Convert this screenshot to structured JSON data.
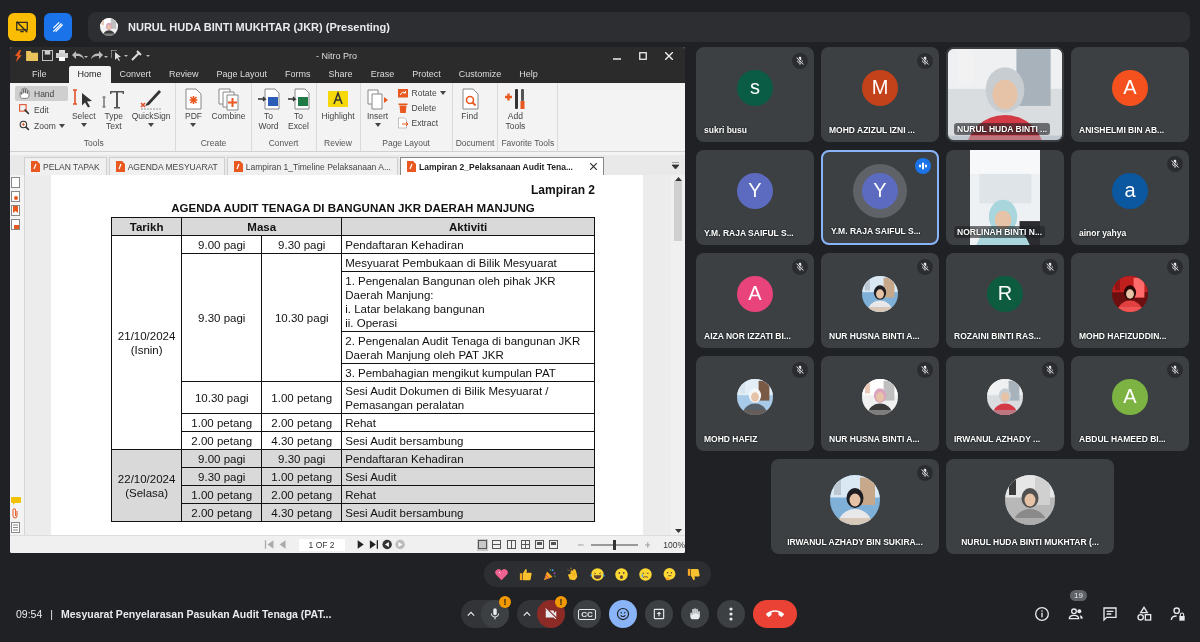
{
  "meet": {
    "presenter": "NURUL HUDA BINTI MUKHTAR (JKR) (Presenting)"
  },
  "nitro": {
    "title": "- Nitro Pro",
    "menu": [
      {
        "label": "File",
        "selected": false
      },
      {
        "label": "Home",
        "selected": true
      },
      {
        "label": "Convert",
        "selected": false
      },
      {
        "label": "Review",
        "selected": false
      },
      {
        "label": "Page Layout",
        "selected": false
      },
      {
        "label": "Forms",
        "selected": false
      },
      {
        "label": "Share",
        "selected": false
      },
      {
        "label": "Erase",
        "selected": false
      },
      {
        "label": "Protect",
        "selected": false
      },
      {
        "label": "Customize",
        "selected": false
      },
      {
        "label": "Help",
        "selected": false
      }
    ],
    "ribbon": [
      {
        "label": "Tools",
        "buttons": [
          {
            "label": "Hand",
            "kind": "small",
            "selected": true,
            "dropdown": false
          },
          {
            "label": "Edit",
            "kind": "small",
            "selected": false,
            "dropdown": false
          },
          {
            "label": "Zoom",
            "kind": "small",
            "selected": false,
            "dropdown": true
          },
          {
            "label": "Select",
            "kind": "large",
            "selected": false,
            "dropdown": true
          },
          {
            "label": "Type\nText",
            "kind": "large",
            "selected": false,
            "dropdown": false
          },
          {
            "label": "QuickSign",
            "kind": "large",
            "selected": false,
            "dropdown": true
          }
        ]
      },
      {
        "label": "Create",
        "buttons": [
          {
            "label": "PDF",
            "kind": "large",
            "selected": false,
            "dropdown": true
          },
          {
            "label": "Combine",
            "kind": "large",
            "selected": false,
            "dropdown": false
          }
        ]
      },
      {
        "label": "Convert",
        "buttons": [
          {
            "label": "To\nWord",
            "kind": "large",
            "selected": false,
            "dropdown": false
          },
          {
            "label": "To\nExcel",
            "kind": "large",
            "selected": false,
            "dropdown": false
          }
        ]
      },
      {
        "label": "Review",
        "buttons": [
          {
            "label": "Highlight",
            "kind": "large",
            "selected": false,
            "dropdown": false
          }
        ]
      },
      {
        "label": "Page Layout",
        "buttons": [
          {
            "label": "Insert",
            "kind": "large",
            "selected": false,
            "dropdown": true
          },
          {
            "label": "Rotate",
            "kind": "small",
            "selected": false,
            "dropdown": true
          },
          {
            "label": "Delete",
            "kind": "small",
            "selected": false,
            "dropdown": false
          },
          {
            "label": "Extract",
            "kind": "small",
            "selected": false,
            "dropdown": false
          }
        ]
      },
      {
        "label": "Document",
        "buttons": [
          {
            "label": "Find",
            "kind": "large",
            "selected": false,
            "dropdown": false
          }
        ]
      },
      {
        "label": "Favorite Tools",
        "buttons": [
          {
            "label": "Add\nTools",
            "kind": "large",
            "selected": false,
            "dropdown": false
          }
        ]
      }
    ],
    "tabs": [
      {
        "label": "PELAN TAPAK",
        "selected": false
      },
      {
        "label": "AGENDA MESYUARAT",
        "selected": false
      },
      {
        "label": "Lampiran 1_Timeline Pelaksanaan A...",
        "selected": false
      },
      {
        "label": "Lampiran 2_Pelaksanaan Audit Tena...",
        "selected": true
      }
    ],
    "page": {
      "heading": "Lampiran 2",
      "title": "AGENDA AUDIT TENAGA DI BANGUNAN JKR DAERAH MANJUNG",
      "columns": [
        "Tarikh",
        "Masa",
        "Aktiviti"
      ],
      "days": [
        {
          "date": "21/10/2024",
          "day": "(Isnin)",
          "shaded": false,
          "sessions": [
            {
              "start": "9.00 pagi",
              "end": "9.30 pagi",
              "activities": [
                "Pendaftaran Kehadiran"
              ]
            },
            {
              "start": "9.30 pagi",
              "end": "10.30 pagi",
              "activities": [
                "Mesyuarat Pembukaan di Bilik Mesyuarat",
                "1. Pengenalan Bangunan oleh pihak JKR\nDaerah Manjung:\ni. Latar belakang bangunan\nii. Operasi",
                "2. Pengenalan Audit Tenaga di bangunan JKR\nDaerah Manjung oleh PAT JKR",
                "3. Pembahagian mengikut kumpulan PAT"
              ]
            },
            {
              "start": "10.30 pagi",
              "end": "1.00 petang",
              "activities": [
                "Sesi Audit Dokumen di Bilik Mesyuarat /\nPemasangan peralatan"
              ]
            },
            {
              "start": "1.00 petang",
              "end": "2.00 petang",
              "activities": [
                "Rehat"
              ]
            },
            {
              "start": "2.00 petang",
              "end": "4.30 petang",
              "activities": [
                "Sesi Audit bersambung"
              ]
            }
          ]
        },
        {
          "date": "22/10/2024",
          "day": "(Selasa)",
          "shaded": true,
          "sessions": [
            {
              "start": "9.00 pagi",
              "end": "9.30 pagi",
              "activities": [
                "Pendaftaran Kehadiran"
              ]
            },
            {
              "start": "9.30 pagi",
              "end": "1.00 petang",
              "activities": [
                "Sesi Audit"
              ]
            },
            {
              "start": "1.00 petang",
              "end": "2.00 petang",
              "activities": [
                "Rehat"
              ]
            },
            {
              "start": "2.00 petang",
              "end": "4.30 petang",
              "activities": [
                "Sesi Audit bersambung"
              ]
            }
          ]
        }
      ]
    },
    "status": {
      "page": "1 OF 2",
      "zoom": "100%",
      "zoom_slider": {
        "level": 0.5
      },
      "views": [
        {
          "selected": true
        },
        {
          "selected": false
        },
        {
          "selected": false
        },
        {
          "selected": false
        },
        {
          "selected": false
        },
        {
          "selected": false
        }
      ]
    }
  },
  "participants": [
    {
      "name": "sukri busu",
      "kind": "initial",
      "initial": "s",
      "color": "#0b5c45",
      "muted": true,
      "speaking": false
    },
    {
      "name": "MOHD AZIZUL IZNI ...",
      "kind": "initial",
      "initial": "M",
      "color": "#c4421a",
      "muted": true,
      "speaking": false
    },
    {
      "name": "NURUL HUDA BINTI ...",
      "kind": "video",
      "muted": false,
      "speaking": false
    },
    {
      "name": "ANISHELMI BIN AB...",
      "kind": "initial",
      "initial": "A",
      "color": "#f4511e",
      "muted": false,
      "speaking": false
    },
    {
      "name": "Y.M. RAJA SAIFUL S...",
      "kind": "initial",
      "initial": "Y",
      "color": "#5c6bc0",
      "muted": false,
      "speaking": false
    },
    {
      "name": "Y.M. RAJA SAIFUL S...",
      "kind": "initial",
      "initial": "Y",
      "color": "#5c6bc0",
      "muted": false,
      "speaking": true
    },
    {
      "name": "NORLINAH BINTI N...",
      "kind": "portrait_video",
      "muted": false,
      "speaking": false
    },
    {
      "name": "ainor yahya",
      "kind": "initial",
      "initial": "a",
      "color": "#0b57a0",
      "muted": true,
      "speaking": false
    },
    {
      "name": "AIZA NOR IZZATI BI...",
      "kind": "initial",
      "initial": "A",
      "color": "#e8437a",
      "muted": true,
      "speaking": false
    },
    {
      "name": "NUR HUSNA BINTI A...",
      "muted": true,
      "speaking": false
    },
    {
      "name": "ROZAINI BINTI RAS...",
      "kind": "initial",
      "initial": "R",
      "color": "#0d5c40",
      "muted": true,
      "speaking": false
    },
    {
      "name": "MOHD HAFIZUDDIN...",
      "muted": true,
      "speaking": false
    },
    {
      "name": "MOHD HAFIZ",
      "muted": true,
      "speaking": false
    },
    {
      "name": "NUR HUSNA BINTI A...",
      "muted": true,
      "speaking": false
    },
    {
      "name": "IRWANUL AZHADY ...",
      "muted": true,
      "speaking": false
    },
    {
      "name": "ABDUL HAMEED BI...",
      "kind": "initial",
      "initial": "A",
      "color": "#7cb342",
      "muted": true,
      "speaking": false
    },
    {
      "name": "IRWANUL AZHADY BIN SUKIRA...",
      "muted": true,
      "speaking": false
    },
    {
      "name": "NURUL HUDA BINTI MUKHTAR (...",
      "muted": false,
      "speaking": false
    }
  ],
  "bottom": {
    "time": "09:54",
    "separator": "|",
    "title": "Mesyuarat Penyelarasan Pasukan Audit Tenaga (PAT...",
    "mic_badge": "!",
    "camera_badge": "!",
    "camera_on": false,
    "captions": "CC",
    "reactions_open": true,
    "people_count": "19"
  }
}
